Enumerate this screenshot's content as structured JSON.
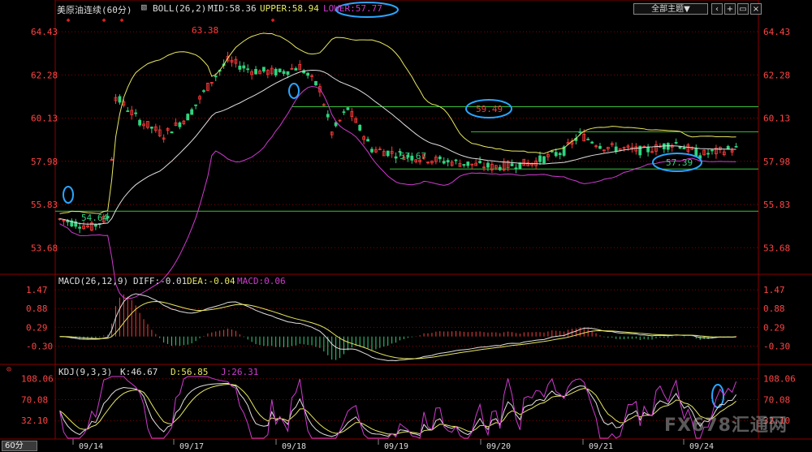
{
  "header": {
    "title": "美原油连续(60分)",
    "boll": "BOLL(26,2)",
    "mid": "MID:58.36",
    "upper": "UPPER:58.94",
    "lower": "LOWER:57.77",
    "theme_label": "全部主题▼"
  },
  "macd_header": {
    "name": "MACD(26,12,9)",
    "diff": "DIFF:-0.01",
    "dea": "DEA:-0.04",
    "macd": "MACD:0.06"
  },
  "kdj_header": {
    "name": "KDJ(9,3,3)",
    "k": "K:46.67",
    "d": "D:56.85",
    "j": "J:26.31"
  },
  "timeframe_label": "60分",
  "watermark": "FX678汇通网",
  "colors": {
    "up": "#ff3b3b",
    "down": "#2fd47f",
    "upper": "#e8e860",
    "mid": "#e0e0e0",
    "lower": "#d03ad0",
    "hline": "#38c038",
    "circle": "#2aa6ff",
    "grid": "#8b0000",
    "kdj_j": "#d03ad0"
  },
  "chart_data": [
    {
      "panel": "price",
      "type": "candlestick",
      "yticks": [
        "64.43",
        "62.28",
        "60.13",
        "57.98",
        "55.83",
        "53.68"
      ],
      "ylim": [
        52.4,
        65.2
      ],
      "xticks": [
        "09/14",
        "09/17",
        "09/18",
        "09/19",
        "09/20",
        "09/21",
        "09/24"
      ],
      "annotations": [
        {
          "label": "63.38",
          "value": 63.38
        },
        {
          "label": "54.64",
          "value": 54.64
        },
        {
          "label": "57.67",
          "value": 57.67
        },
        {
          "label": "59.49",
          "value": 59.49
        },
        {
          "label": "57.39",
          "value": 57.39
        }
      ],
      "horizontal_lines": [
        60.7,
        59.45,
        57.6,
        55.5
      ],
      "series": [
        {
          "name": "UPPER"
        },
        {
          "name": "MID"
        },
        {
          "name": "LOWER"
        }
      ]
    },
    {
      "panel": "macd",
      "type": "bar+line",
      "yticks": [
        "1.47",
        "0.88",
        "0.29",
        "-0.30"
      ],
      "ylim": [
        -0.85,
        1.6
      ],
      "series": [
        {
          "name": "DIFF"
        },
        {
          "name": "DEA"
        },
        {
          "name": "MACD"
        }
      ]
    },
    {
      "panel": "kdj",
      "type": "line",
      "yticks": [
        "108.06",
        "70.08",
        "32.10"
      ],
      "ylim": [
        0,
        115
      ],
      "series": [
        {
          "name": "K"
        },
        {
          "name": "D"
        },
        {
          "name": "J"
        }
      ]
    }
  ]
}
